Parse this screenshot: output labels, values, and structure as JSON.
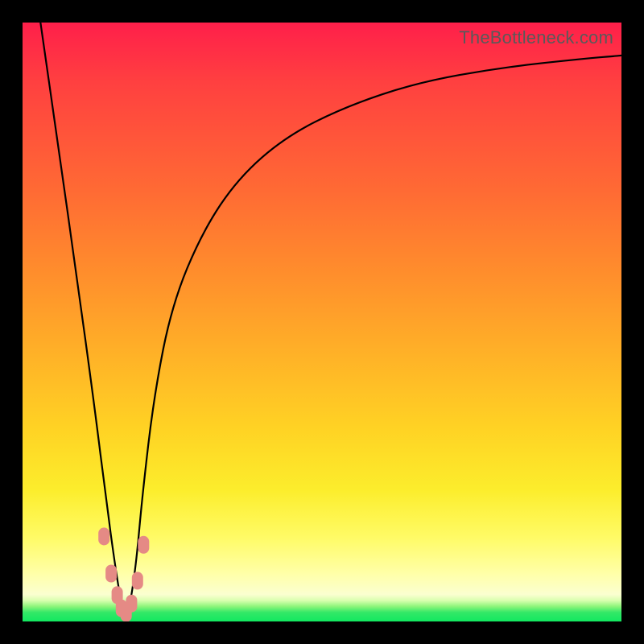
{
  "watermark": "TheBottleneck.com",
  "chart_data": {
    "type": "line",
    "title": "",
    "xlabel": "",
    "ylabel": "",
    "xlim": [
      0,
      100
    ],
    "ylim": [
      0,
      100
    ],
    "grid": false,
    "legend": false,
    "series": [
      {
        "name": "bottleneck-curve",
        "color": "#000000",
        "x": [
          3,
          6,
          9,
          12,
          14,
          15.5,
          16.5,
          17.3,
          18,
          19,
          20,
          22,
          25,
          30,
          36,
          44,
          54,
          66,
          80,
          94,
          100
        ],
        "y": [
          100,
          79,
          58,
          36,
          20,
          9,
          3,
          1,
          3,
          10,
          21,
          38,
          53,
          65,
          74,
          81,
          86,
          90,
          92.5,
          94,
          94.5
        ]
      }
    ],
    "markers": [
      {
        "name": "cluster-dots",
        "shape": "rounded-rect",
        "color": "#e58a85",
        "points": [
          {
            "x": 13.6,
            "y": 14.2
          },
          {
            "x": 14.8,
            "y": 8.0
          },
          {
            "x": 15.8,
            "y": 4.4
          },
          {
            "x": 16.5,
            "y": 2.2
          },
          {
            "x": 17.3,
            "y": 1.4
          },
          {
            "x": 18.2,
            "y": 3.0
          },
          {
            "x": 19.2,
            "y": 6.8
          },
          {
            "x": 20.2,
            "y": 12.8
          }
        ]
      }
    ],
    "background_gradient": {
      "type": "vertical",
      "stops": [
        {
          "pos": 0,
          "color": "#ff1f4a"
        },
        {
          "pos": 50,
          "color": "#ff9a2c"
        },
        {
          "pos": 82,
          "color": "#fffb66"
        },
        {
          "pos": 100,
          "color": "#12e860"
        }
      ]
    }
  }
}
